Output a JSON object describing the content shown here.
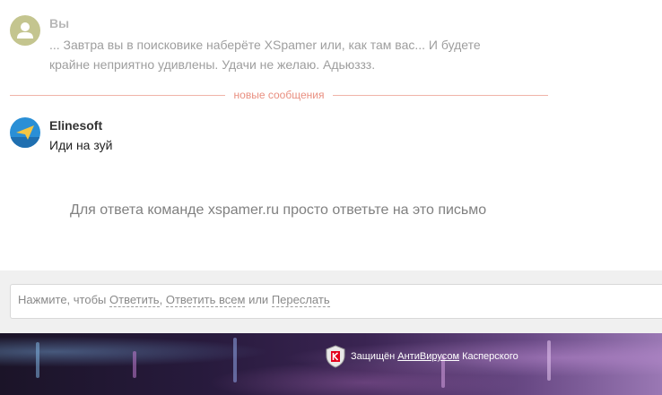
{
  "messages": [
    {
      "sender": "Вы",
      "text": "... Завтра вы в поисковике наберёте XSpamer или, как там вас... И будете крайне неприятно удивлены. Удачи не желаю. Адьюззз.",
      "avatar_icon": "user-silhouette-icon",
      "avatar_color": "#c4c58f"
    },
    {
      "sender": "Elinesoft",
      "text": "Иди на зуй",
      "avatar_icon": "paper-plane-icon",
      "avatar_color": "#2a8fd6"
    }
  ],
  "divider": {
    "label": "новые сообщения",
    "color": "#e98f80"
  },
  "reply_hint": "Для ответа команде xspamer.ru просто ответьте на это письмо",
  "reply_bar": {
    "prefix": "Нажмите, чтобы",
    "reply": "Ответить",
    "comma": ",",
    "reply_all": "Ответить всем",
    "or": "или",
    "forward": "Переслать"
  },
  "footer": {
    "protected_text": "Защищён",
    "antivirus_link": "АнтиВирусом",
    "vendor": "Касперского",
    "shield_icon": "kaspersky-shield-icon",
    "brand_color": "#e3001b"
  }
}
